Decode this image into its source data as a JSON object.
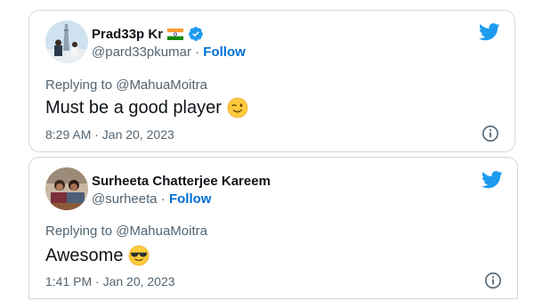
{
  "tweets": [
    {
      "display_name": "Prad33p Kr",
      "flag_icon": "india-flag-icon",
      "verified_icon": "verified-badge-icon",
      "handle": "@pard33pkumar",
      "separator": " · ",
      "follow_label": "Follow",
      "replying_to": "Replying to @MahuaMoitra",
      "text": "Must be a good player",
      "emoji_icon": "winking-face-emoji",
      "timestamp": "8:29 AM · Jan 20, 2023"
    },
    {
      "display_name": "Surheeta Chatterjee Kareem",
      "handle": "@surheeta",
      "separator": " · ",
      "follow_label": "Follow",
      "replying_to": "Replying to @MahuaMoitra",
      "text": "Awesome",
      "emoji_icon": "sunglasses-face-emoji",
      "timestamp": "1:41 PM · Jan 20, 2023"
    }
  ],
  "colors": {
    "twitter_blue": "#1d9bf0",
    "follow_blue": "#006fd6",
    "secondary_text": "#536471",
    "primary_text": "#0f1419",
    "border": "#cfd9de"
  }
}
